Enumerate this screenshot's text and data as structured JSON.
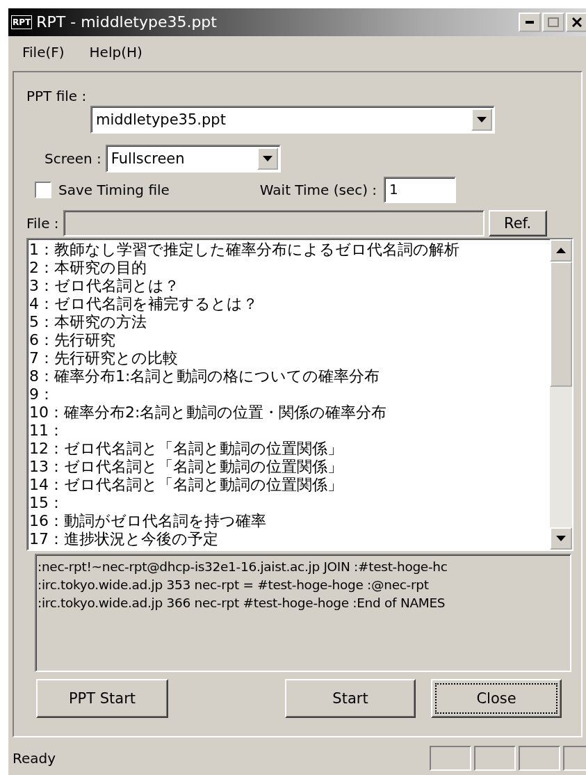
{
  "window": {
    "title": "RPT - middletype35.ppt",
    "icon_text": "RPT"
  },
  "menu": [
    "File(F)",
    "Help(H)"
  ],
  "ppt_file": {
    "label": "PPT file :",
    "value": "middletype35.ppt"
  },
  "screen": {
    "label": "Screen :",
    "value": "Fullscreen"
  },
  "save_timing": {
    "label": "Save Timing file",
    "checked": false
  },
  "wait_time": {
    "label": "Wait Time (sec) :",
    "value": "1"
  },
  "file": {
    "label": "File :",
    "disabled": true,
    "button": "Ref."
  },
  "slides": [
    "1：教師なし学習で推定した確率分布によるゼロ代名詞の解析",
    "2：本研究の目的",
    "3：ゼロ代名詞とは？",
    "4：ゼロ代名詞を補完するとは？",
    "5：本研究の方法",
    "6：先行研究",
    "7：先行研究との比較",
    "8：確率分布1:名詞と動詞の格についての確率分布",
    "9：",
    "10：確率分布2:名詞と動詞の位置・関係の確率分布",
    "11：",
    "12：ゼロ代名詞と「名詞と動詞の位置関係」",
    "13：ゼロ代名詞と「名詞と動詞の位置関係」",
    "14：ゼロ代名詞と「名詞と動詞の位置関係」",
    "15：",
    "16：動詞がゼロ代名詞を持つ確率",
    "17：進捗状況と今後の予定"
  ],
  "log": [
    ":nec-rpt!~nec-rpt@dhcp-is32e1-16.jaist.ac.jp JOIN :#test-hoge-hc",
    ":irc.tokyo.wide.ad.jp 353 nec-rpt = #test-hoge-hoge :@nec-rpt",
    ":irc.tokyo.wide.ad.jp 366 nec-rpt #test-hoge-hoge :End of NAMES"
  ],
  "buttons": [
    {
      "label": "PPT Start",
      "focused": false
    },
    {
      "label": "Start",
      "focused": false
    },
    {
      "label": "Close",
      "focused": true
    }
  ],
  "status_bar": {
    "text": "Ready"
  }
}
